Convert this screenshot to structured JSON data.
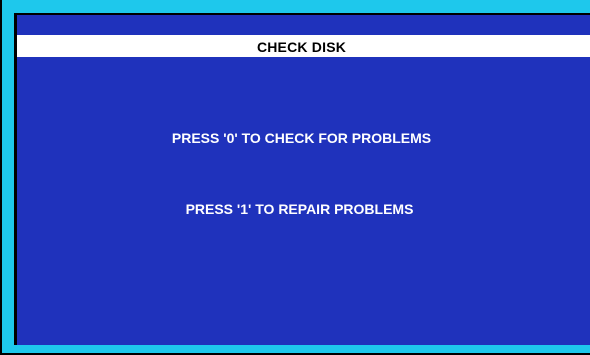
{
  "dialog": {
    "title": "CHECK DISK",
    "options": [
      {
        "label": "PRESS '0' TO CHECK FOR PROBLEMS"
      },
      {
        "label": "PRESS '1' TO REPAIR PROBLEMS"
      }
    ]
  },
  "colors": {
    "frame": "#1ec8ec",
    "screen_background": "#1f32bc",
    "title_bar": "#ffffff",
    "title_text": "#000000",
    "option_text": "#ffffff"
  }
}
